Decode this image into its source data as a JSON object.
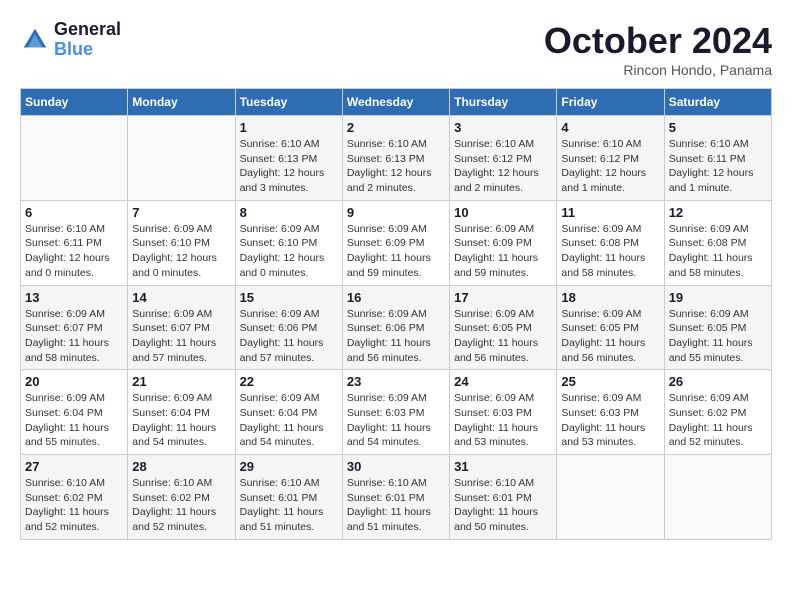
{
  "header": {
    "logo_line1": "General",
    "logo_line2": "Blue",
    "month_title": "October 2024",
    "location": "Rincon Hondo, Panama"
  },
  "weekdays": [
    "Sunday",
    "Monday",
    "Tuesday",
    "Wednesday",
    "Thursday",
    "Friday",
    "Saturday"
  ],
  "weeks": [
    [
      {
        "day": "",
        "info": ""
      },
      {
        "day": "",
        "info": ""
      },
      {
        "day": "1",
        "info": "Sunrise: 6:10 AM\nSunset: 6:13 PM\nDaylight: 12 hours and 3 minutes."
      },
      {
        "day": "2",
        "info": "Sunrise: 6:10 AM\nSunset: 6:13 PM\nDaylight: 12 hours and 2 minutes."
      },
      {
        "day": "3",
        "info": "Sunrise: 6:10 AM\nSunset: 6:12 PM\nDaylight: 12 hours and 2 minutes."
      },
      {
        "day": "4",
        "info": "Sunrise: 6:10 AM\nSunset: 6:12 PM\nDaylight: 12 hours and 1 minute."
      },
      {
        "day": "5",
        "info": "Sunrise: 6:10 AM\nSunset: 6:11 PM\nDaylight: 12 hours and 1 minute."
      }
    ],
    [
      {
        "day": "6",
        "info": "Sunrise: 6:10 AM\nSunset: 6:11 PM\nDaylight: 12 hours and 0 minutes."
      },
      {
        "day": "7",
        "info": "Sunrise: 6:09 AM\nSunset: 6:10 PM\nDaylight: 12 hours and 0 minutes."
      },
      {
        "day": "8",
        "info": "Sunrise: 6:09 AM\nSunset: 6:10 PM\nDaylight: 12 hours and 0 minutes."
      },
      {
        "day": "9",
        "info": "Sunrise: 6:09 AM\nSunset: 6:09 PM\nDaylight: 11 hours and 59 minutes."
      },
      {
        "day": "10",
        "info": "Sunrise: 6:09 AM\nSunset: 6:09 PM\nDaylight: 11 hours and 59 minutes."
      },
      {
        "day": "11",
        "info": "Sunrise: 6:09 AM\nSunset: 6:08 PM\nDaylight: 11 hours and 58 minutes."
      },
      {
        "day": "12",
        "info": "Sunrise: 6:09 AM\nSunset: 6:08 PM\nDaylight: 11 hours and 58 minutes."
      }
    ],
    [
      {
        "day": "13",
        "info": "Sunrise: 6:09 AM\nSunset: 6:07 PM\nDaylight: 11 hours and 58 minutes."
      },
      {
        "day": "14",
        "info": "Sunrise: 6:09 AM\nSunset: 6:07 PM\nDaylight: 11 hours and 57 minutes."
      },
      {
        "day": "15",
        "info": "Sunrise: 6:09 AM\nSunset: 6:06 PM\nDaylight: 11 hours and 57 minutes."
      },
      {
        "day": "16",
        "info": "Sunrise: 6:09 AM\nSunset: 6:06 PM\nDaylight: 11 hours and 56 minutes."
      },
      {
        "day": "17",
        "info": "Sunrise: 6:09 AM\nSunset: 6:05 PM\nDaylight: 11 hours and 56 minutes."
      },
      {
        "day": "18",
        "info": "Sunrise: 6:09 AM\nSunset: 6:05 PM\nDaylight: 11 hours and 56 minutes."
      },
      {
        "day": "19",
        "info": "Sunrise: 6:09 AM\nSunset: 6:05 PM\nDaylight: 11 hours and 55 minutes."
      }
    ],
    [
      {
        "day": "20",
        "info": "Sunrise: 6:09 AM\nSunset: 6:04 PM\nDaylight: 11 hours and 55 minutes."
      },
      {
        "day": "21",
        "info": "Sunrise: 6:09 AM\nSunset: 6:04 PM\nDaylight: 11 hours and 54 minutes."
      },
      {
        "day": "22",
        "info": "Sunrise: 6:09 AM\nSunset: 6:04 PM\nDaylight: 11 hours and 54 minutes."
      },
      {
        "day": "23",
        "info": "Sunrise: 6:09 AM\nSunset: 6:03 PM\nDaylight: 11 hours and 54 minutes."
      },
      {
        "day": "24",
        "info": "Sunrise: 6:09 AM\nSunset: 6:03 PM\nDaylight: 11 hours and 53 minutes."
      },
      {
        "day": "25",
        "info": "Sunrise: 6:09 AM\nSunset: 6:03 PM\nDaylight: 11 hours and 53 minutes."
      },
      {
        "day": "26",
        "info": "Sunrise: 6:09 AM\nSunset: 6:02 PM\nDaylight: 11 hours and 52 minutes."
      }
    ],
    [
      {
        "day": "27",
        "info": "Sunrise: 6:10 AM\nSunset: 6:02 PM\nDaylight: 11 hours and 52 minutes."
      },
      {
        "day": "28",
        "info": "Sunrise: 6:10 AM\nSunset: 6:02 PM\nDaylight: 11 hours and 52 minutes."
      },
      {
        "day": "29",
        "info": "Sunrise: 6:10 AM\nSunset: 6:01 PM\nDaylight: 11 hours and 51 minutes."
      },
      {
        "day": "30",
        "info": "Sunrise: 6:10 AM\nSunset: 6:01 PM\nDaylight: 11 hours and 51 minutes."
      },
      {
        "day": "31",
        "info": "Sunrise: 6:10 AM\nSunset: 6:01 PM\nDaylight: 11 hours and 50 minutes."
      },
      {
        "day": "",
        "info": ""
      },
      {
        "day": "",
        "info": ""
      }
    ]
  ]
}
